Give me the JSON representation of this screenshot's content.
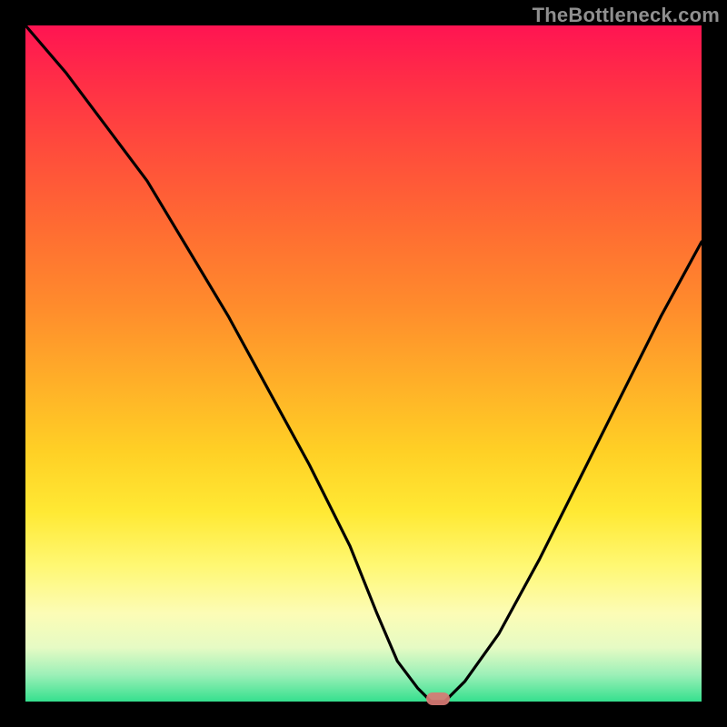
{
  "watermark": "TheBottleneck.com",
  "chart_data": {
    "type": "line",
    "title": "",
    "xlabel": "",
    "ylabel": "",
    "xlim": [
      0,
      100
    ],
    "ylim": [
      0,
      100
    ],
    "series": [
      {
        "name": "curve",
        "x": [
          0,
          6,
          12,
          18,
          24,
          30,
          36,
          42,
          48,
          52,
          55,
          58,
          60,
          62,
          65,
          70,
          76,
          82,
          88,
          94,
          100
        ],
        "values": [
          100,
          93,
          85,
          77,
          67,
          57,
          46,
          35,
          23,
          13,
          6,
          2,
          0,
          0,
          3,
          10,
          21,
          33,
          45,
          57,
          68
        ]
      }
    ],
    "minimum_marker": {
      "x": 61,
      "y": 0
    },
    "gradient_note": "background encodes value: red=high, green=low"
  },
  "colors": {
    "curve": "#000000",
    "marker": "#d87a74",
    "frame": "#000000"
  }
}
